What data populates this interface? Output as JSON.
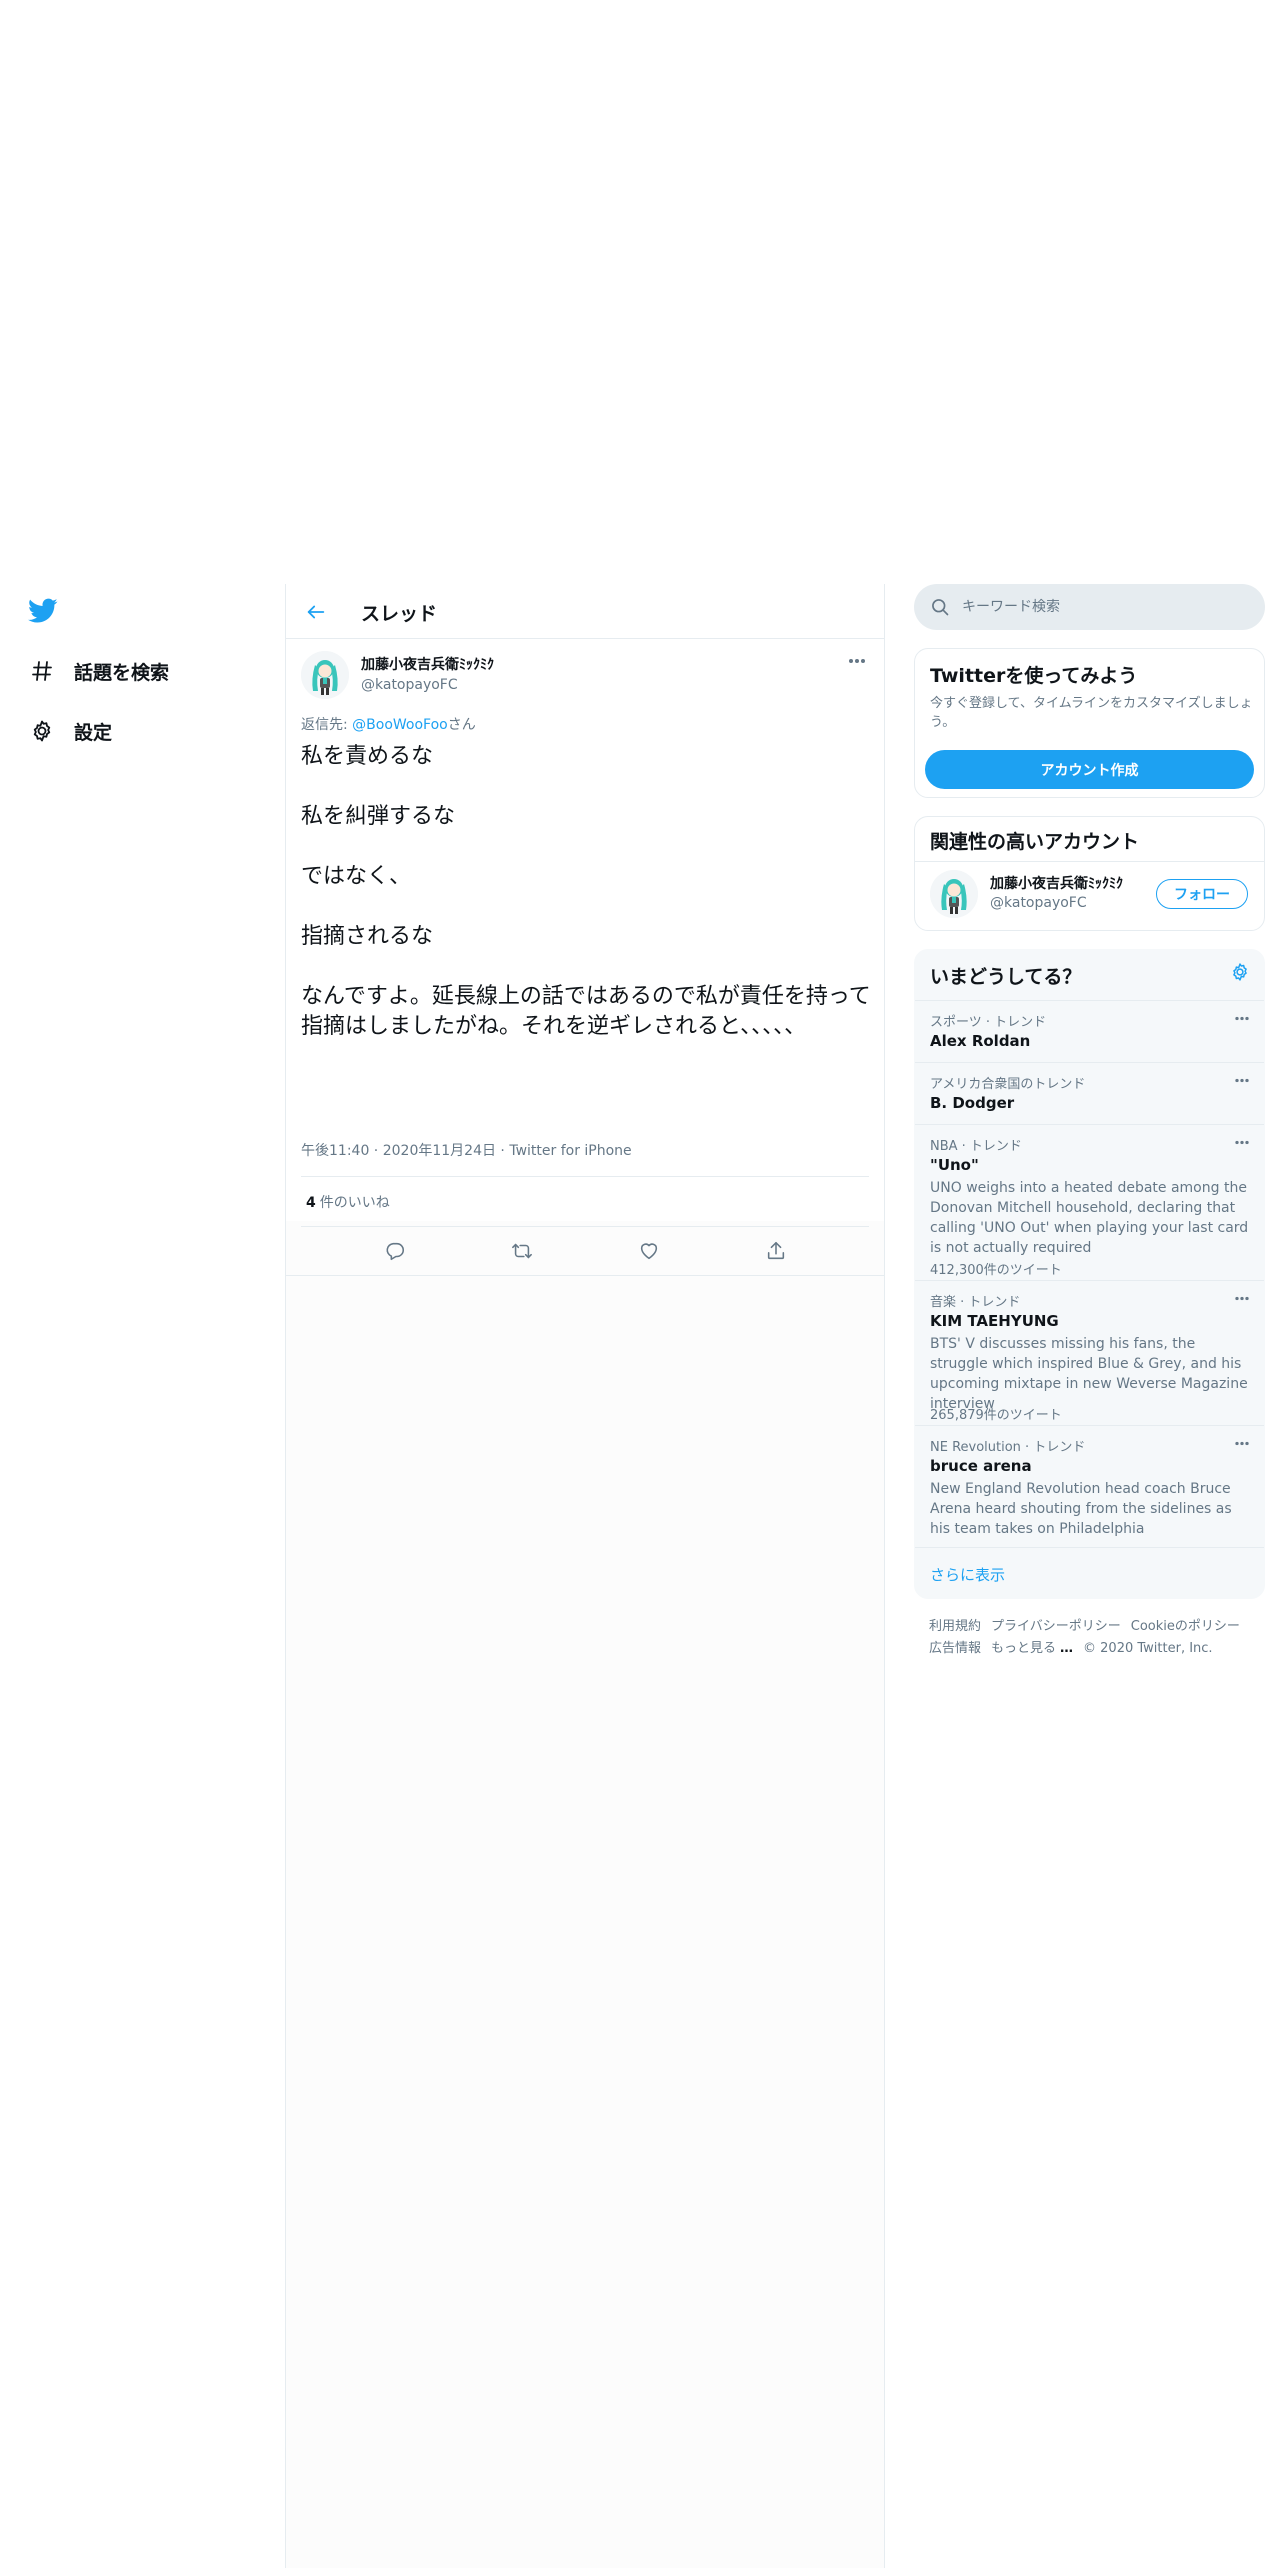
{
  "nav": {
    "explore_label": "話題を検索",
    "settings_label": "設定"
  },
  "main": {
    "title": "スレッド",
    "tweet": {
      "author_name": "加藤小夜吉兵衛ﾐｯｸﾐｸ",
      "author_handle": "@katopayoFC",
      "reply_prefix": "返信先: ",
      "reply_to": "@BooWooFoo",
      "reply_suffix": "さん",
      "text": "私を責めるな\n\n私を糾弾するな\n\nではなく、\n\n指摘されるな\n\nなんですよ。延長線上の話ではあるので私が責任を持って指摘はしましたがね。それを逆ギレされると、、、、、",
      "time": "午後11:40",
      "date": "2020年11月24日",
      "source": "Twitter for iPhone",
      "likes_count": "4",
      "likes_label": "件のいいね"
    }
  },
  "sidebar": {
    "search_placeholder": "キーワード検索",
    "signup": {
      "title": "Twitterを使ってみよう",
      "body": "今すぐ登録して、タイムラインをカスタマイズしましょう。",
      "button": "アカウント作成"
    },
    "related": {
      "title": "関連性の高いアカウント",
      "name": "加藤小夜吉兵衛ﾐｯｸﾐｸ",
      "handle": "@katopayoFC",
      "follow": "フォロー"
    },
    "trends": {
      "title": "いまどうしてる？",
      "items": [
        {
          "meta": "スポーツ · トレンド",
          "name": "Alex Roldan",
          "desc": "",
          "count": ""
        },
        {
          "meta": "アメリカ合衆国のトレンド",
          "name": "B. Dodger",
          "desc": "",
          "count": ""
        },
        {
          "meta": "NBA · トレンド",
          "name": "\"Uno\"",
          "desc": "UNO weighs into a heated debate among the Donovan Mitchell household, declaring that calling 'UNO Out' when playing your last card is not actually required",
          "count": "412,300件のツイート"
        },
        {
          "meta": "音楽 · トレンド",
          "name": "KIM TAEHYUNG",
          "desc": "BTS' V discusses missing his fans, the struggle which inspired Blue & Grey, and his upcoming mixtape in new Weverse Magazine interview",
          "count": "265,879件のツイート"
        },
        {
          "meta": "NE Revolution · トレンド",
          "name": "bruce arena",
          "desc": "New England Revolution head coach Bruce Arena heard shouting from the sidelines as his team takes on Philadelphia",
          "count": ""
        }
      ],
      "show_more": "さらに表示"
    },
    "footer": {
      "terms": "利用規約",
      "privacy": "プライバシーポリシー",
      "cookie": "Cookieのポリシー",
      "ads": "広告情報",
      "more": "もっと見る",
      "copyright": "© 2020 Twitter, Inc."
    }
  },
  "colors": {
    "accent": "#1da1f2",
    "text": "#0f1419",
    "secondary": "#657786",
    "border": "#e6ecf0"
  }
}
